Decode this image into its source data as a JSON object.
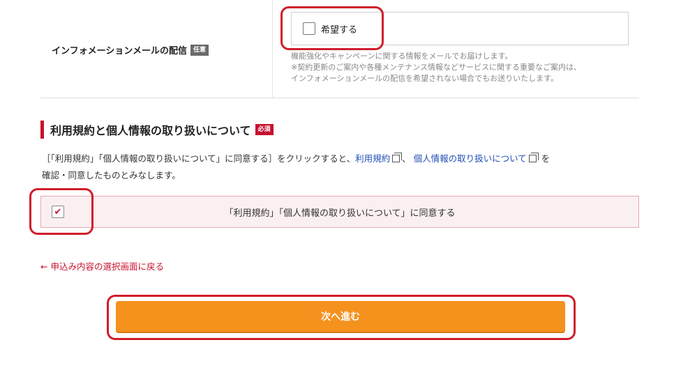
{
  "info_mail": {
    "label": "インフォメーションメールの配信",
    "badge": "任意",
    "checkbox_label": "希望する",
    "checked": false,
    "notes": [
      "機能強化やキャンペーンに関する情報をメールでお届けします。",
      "※契約更新のご案内や各種メンテナンス情報などサービスに関する重要なご案内は、",
      "インフォメーションメールの配信を希望されない場合でもお送りいたします。"
    ]
  },
  "terms": {
    "title": "利用規約と個人情報の取り扱いについて",
    "badge": "必須",
    "text_prefix": "［「利用規約」「個人情報の取り扱いについて」に同意する］をクリックすると、",
    "link_terms": "利用規約",
    "separator": "、",
    "link_privacy": "個人情報の取り扱いについて",
    "text_suffix_1": "を",
    "text_line2": "確認・同意したものとみなします。",
    "agree_label": "「利用規約」「個人情報の取り扱いについて」に同意する",
    "agree_checked": true,
    "check_mark": "✔"
  },
  "back_link": "← 申込み内容の選択画面に戻る",
  "next_button": "次へ進む",
  "colors": {
    "accent_red": "#c8102e",
    "button_orange": "#f5921e",
    "link_blue": "#1f4fb5",
    "highlight_frame": "#d01c2a"
  }
}
